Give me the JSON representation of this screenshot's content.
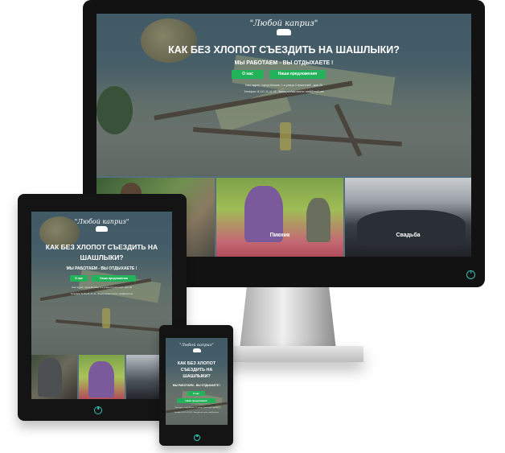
{
  "site": {
    "logo": "\"Любой каприз\"",
    "headline": "КАК БЕЗ ХЛОПОТ СЪЕЗДИТЬ НА ШАШЛЫКИ?",
    "headline_line1": "КАК БЕЗ ХЛОПОТ",
    "headline_line2": "СЪЕЗДИТЬ НА",
    "headline_line3": "ШАШЛЫКИ?",
    "tablet_headline_line1": "КАК БЕЗ ХЛОПОТ СЪЕЗДИТЬ НА",
    "tablet_headline_line2": "ШАШЛЫКИ?",
    "subtitle": "МЫ РАБОТАЕМ - ВЫ ОТДЫХАЕТЕ !",
    "about_button": "О нас",
    "offers_button": "Наши предложения",
    "address": "Наш адрес: город Москва, 1-я улица Строителей , дом 25",
    "phone": "Телефон: 8-111-11-11-11, Электронная почта: mail@mail.net"
  },
  "tiles": {
    "picnic": "Пикник",
    "wedding": "Свадьба"
  },
  "colors": {
    "accent": "#22b35a",
    "bezel": "#111111",
    "power_icon": "#2fc3b6"
  },
  "icons": [
    "car-icon",
    "power-icon"
  ]
}
